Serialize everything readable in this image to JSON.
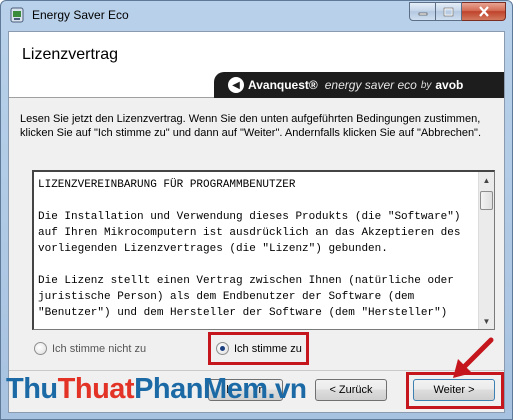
{
  "window": {
    "title": "Energy Saver Eco"
  },
  "header": {
    "title": "Lizenzvertrag",
    "banner": {
      "brand": "Avanquest®",
      "product": "energy saver eco",
      "by": "by",
      "partner": "avob"
    }
  },
  "intro_text": "Lesen Sie jetzt den Lizenzvertrag. Wenn Sie den unten aufgeführten Bedingungen zustimmen, klicken Sie auf  \"Ich stimme zu\" und dann auf \"Weiter\". Andernfalls klicken Sie auf \"Abbrechen\".",
  "license": {
    "text": "LIZENZVEREINBARUNG FÜR PROGRAMMBENUTZER\n\nDie Installation und Verwendung dieses Produkts (die \"Software\") auf Ihren Mikrocomputern ist ausdrücklich an das Akzeptieren des vorliegenden Lizenzvertrages (die \"Lizenz\") gebunden.\n\nDie Lizenz stellt einen Vertrag zwischen Ihnen (natürliche oder juristische Person) als dem Endbenutzer der Software (dem \"Benutzer\") und dem Hersteller der Software (dem \"Hersteller\")"
  },
  "options": {
    "decline": "Ich stimme nicht zu",
    "accept": "Ich stimme zu",
    "selected": "accept"
  },
  "buttons": {
    "back": "< Zurück",
    "next": "Weiter >",
    "partial_left": "b",
    "partial_right": "n"
  },
  "watermark": {
    "part1": "Thu",
    "part2": "Thuat",
    "part3": "PhanMem",
    "part4": ".vn"
  },
  "colors": {
    "highlight": "#c4161c",
    "watermark_blue": "#1b6aa6",
    "watermark_red": "#e23326"
  }
}
